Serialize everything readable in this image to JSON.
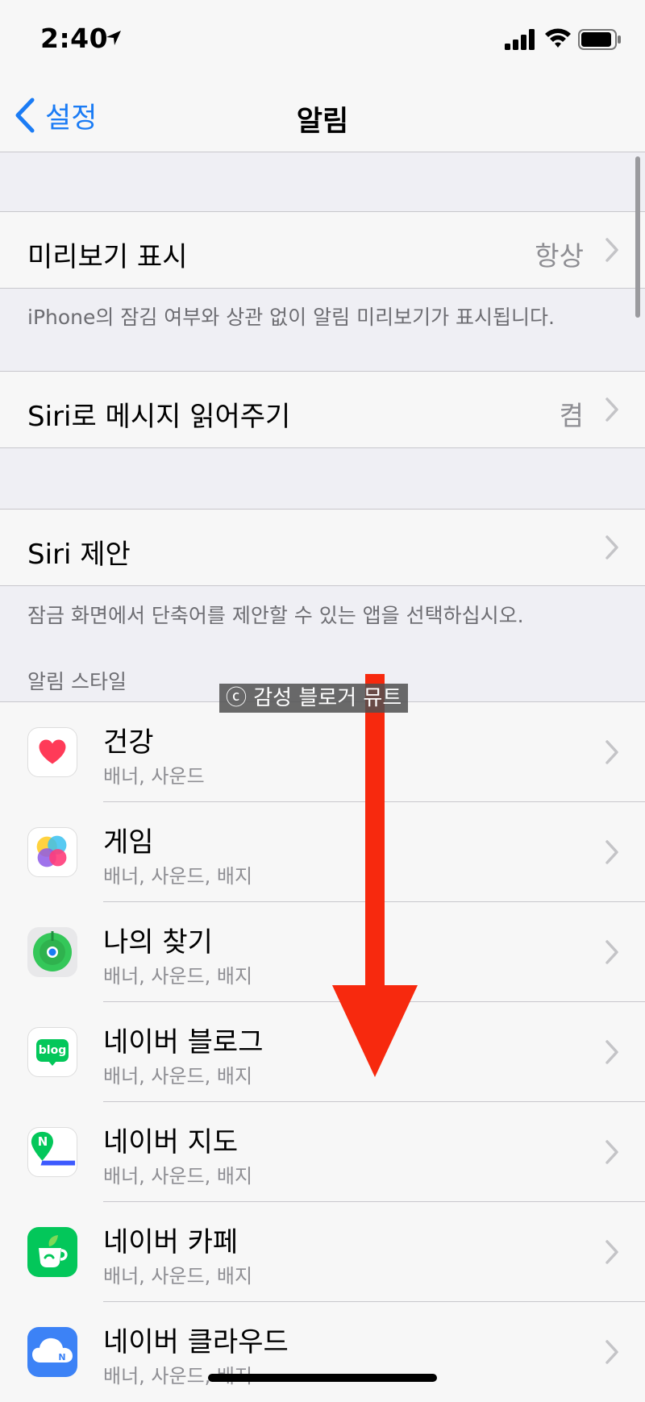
{
  "status": {
    "time": "2:40"
  },
  "nav": {
    "back_label": "설정",
    "title": "알림"
  },
  "preview": {
    "label": "미리보기 표시",
    "value": "항상",
    "footer": "iPhone의 잠김 여부와 상관 없이 알림 미리보기가 표시됩니다."
  },
  "siri_read": {
    "label": "Siri로 메시지 읽어주기",
    "value": "켬"
  },
  "siri_suggest": {
    "label": "Siri 제안",
    "footer": "잠금 화면에서 단축어를 제안할 수 있는 앱을 선택하십시오."
  },
  "style_header": "알림 스타일",
  "apps": [
    {
      "name": "건강",
      "sub": "배너, 사운드",
      "icon": "health-icon"
    },
    {
      "name": "게임",
      "sub": "배너, 사운드, 배지",
      "icon": "game-center-icon"
    },
    {
      "name": "나의 찾기",
      "sub": "배너, 사운드, 배지",
      "icon": "find-my-icon"
    },
    {
      "name": "네이버 블로그",
      "sub": "배너, 사운드, 배지",
      "icon": "naver-blog-icon",
      "icon_text": "blog"
    },
    {
      "name": "네이버 지도",
      "sub": "배너, 사운드, 배지",
      "icon": "naver-map-icon",
      "icon_text": "N"
    },
    {
      "name": "네이버 카페",
      "sub": "배너, 사운드, 배지",
      "icon": "naver-cafe-icon"
    },
    {
      "name": "네이버 클라우드",
      "sub": "배너, 사운드, 배지",
      "icon": "naver-cloud-icon",
      "icon_text": "N"
    }
  ],
  "watermark": "ⓒ 감성 블로거 뮤트",
  "colors": {
    "accent": "#1B7CF5",
    "background": "#EFEFF4",
    "arrow": "#F7290E"
  }
}
